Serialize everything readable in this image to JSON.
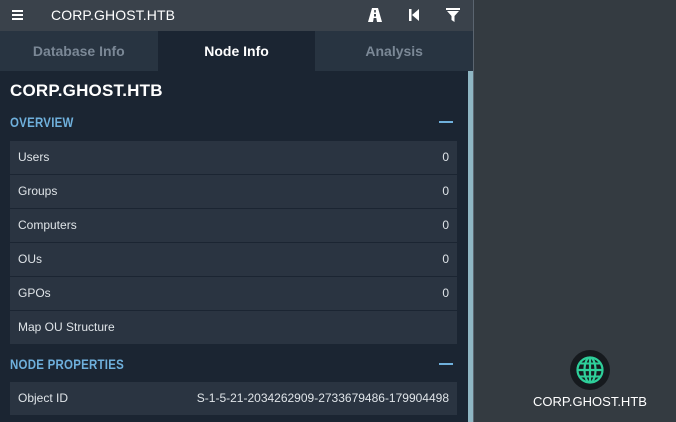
{
  "topbar": {
    "title": "CORP.GHOST.HTB",
    "icons": [
      "menu-icon",
      "pathfinding-road-icon",
      "back-skip-icon",
      "filter-icon"
    ]
  },
  "tabs": [
    {
      "label": "Database Info",
      "active": false
    },
    {
      "label": "Node Info",
      "active": true
    },
    {
      "label": "Analysis",
      "active": false
    }
  ],
  "node": {
    "title": "CORP.GHOST.HTB"
  },
  "overview": {
    "title": "OVERVIEW",
    "rows": [
      {
        "label": "Users",
        "value": "0"
      },
      {
        "label": "Groups",
        "value": "0"
      },
      {
        "label": "Computers",
        "value": "0"
      },
      {
        "label": "OUs",
        "value": "0"
      },
      {
        "label": "GPOs",
        "value": "0"
      },
      {
        "label": "Map OU Structure",
        "value": ""
      }
    ]
  },
  "properties": {
    "title": "NODE PROPERTIES",
    "rows": [
      {
        "label": "Object ID",
        "value": "S-1-5-21-2034262909-2733679486-179904498"
      }
    ]
  },
  "graph": {
    "node_label": "CORP.GHOST.HTB",
    "node_icon": "globe-icon",
    "node_color": "#2ecf9a"
  },
  "colors": {
    "panel_bg": "#1b2532",
    "canvas_bg": "#343b41",
    "accent": "#6fb0dc",
    "scrollbar": "#8fb6c3"
  }
}
